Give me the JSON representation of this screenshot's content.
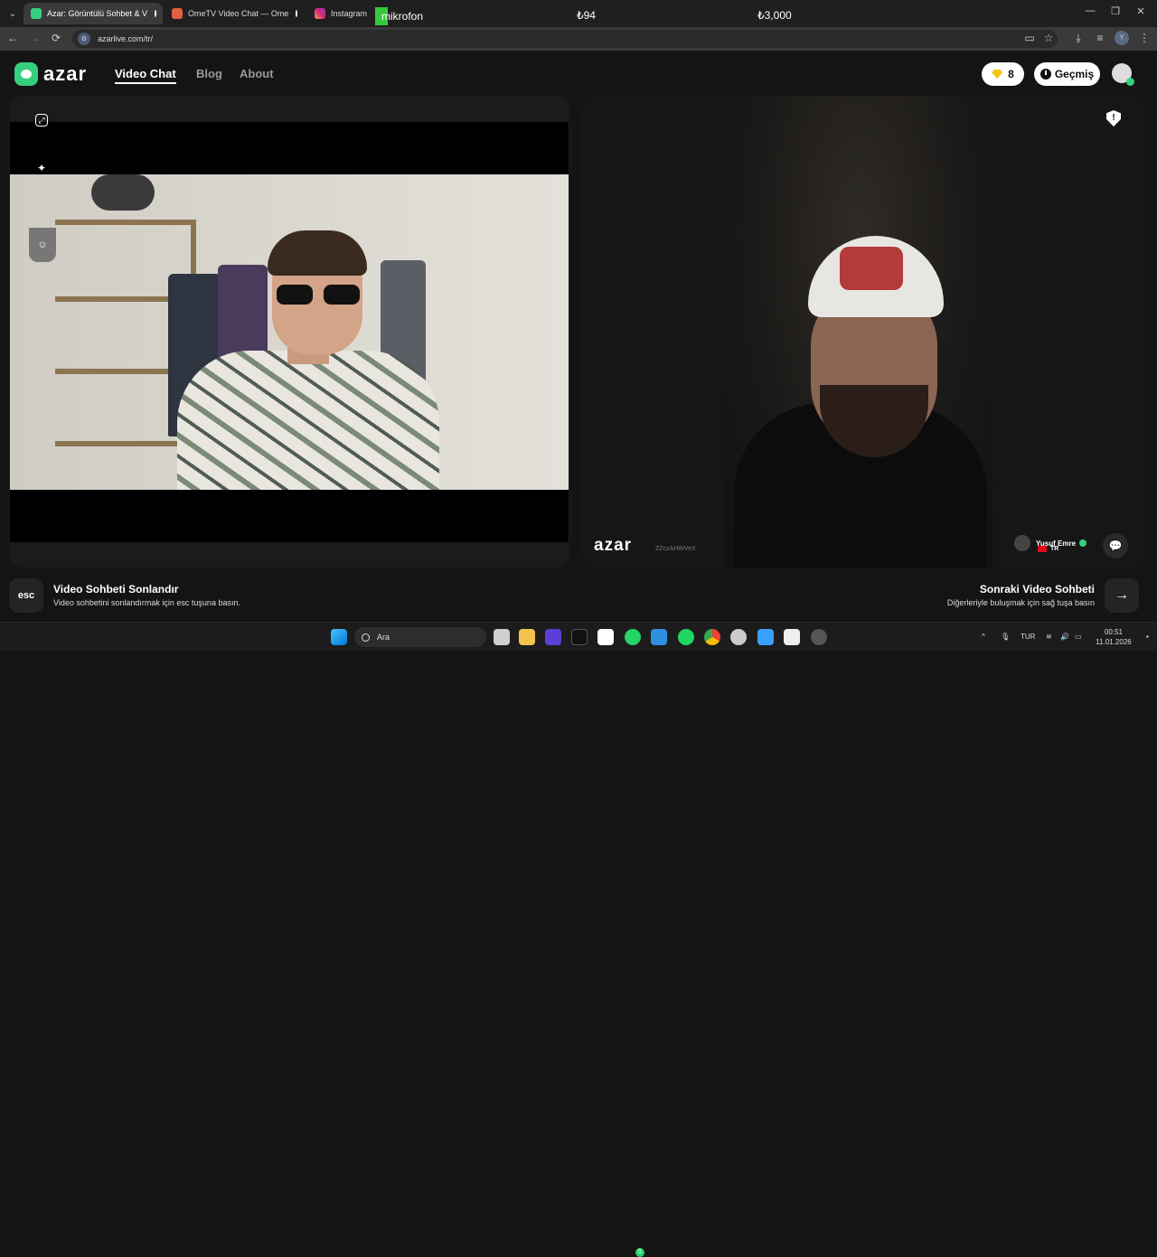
{
  "browser": {
    "tabs": [
      {
        "title": "Azar: Görüntülü Sohbet & V",
        "active": true
      },
      {
        "title": "OmeTV Video Chat — Ome",
        "active": false
      },
      {
        "title": "Instagram",
        "active": false
      }
    ],
    "url": "azarlive.com/tr/",
    "profile_initial": "Y"
  },
  "overlay": {
    "mic_label": "mikrofon",
    "value_1": "₺94",
    "value_2": "₺3,000"
  },
  "header": {
    "brand": "azar",
    "nav": [
      "Video Chat",
      "Blog",
      "About"
    ],
    "gems": "8",
    "history_label": "Geçmiş"
  },
  "peer": {
    "watermark": "azar",
    "code": "ZZczAHWVeX",
    "name": "Yusuf Emre",
    "country": "TR"
  },
  "hints": {
    "esc_key": "esc",
    "end_title": "Video Sohbeti Sonlandır",
    "end_sub": "Video sohbetini sonlandırmak için esc tuşuna basın.",
    "next_title": "Sonraki Video Sohbeti",
    "next_sub": "Diğerleriyle buluşmak için sağ tuşa basın"
  },
  "taskbar": {
    "search_placeholder": "Ara",
    "lang": "TUR",
    "time": "00:51",
    "date": "11.01.2026",
    "whatsapp_badge": "5"
  },
  "colors": {
    "accent": "#35d07f",
    "gem": "#f5c518",
    "background": "#141414"
  }
}
